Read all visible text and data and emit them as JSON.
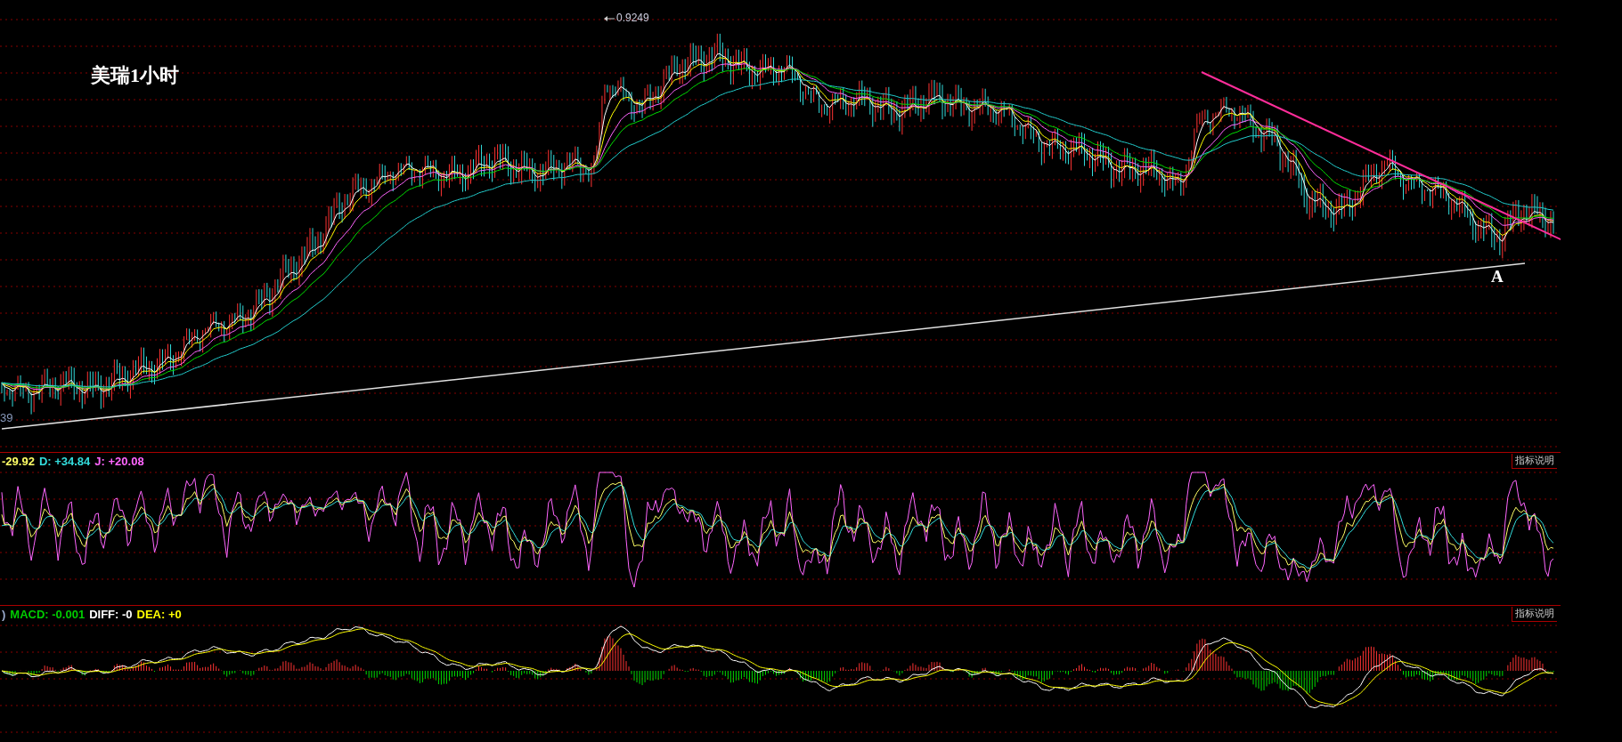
{
  "title": "美瑞1小时",
  "high_label": "0.9249",
  "low_label": "39",
  "point_label": "A",
  "kdj": {
    "readings": [
      {
        "text": "-29.92",
        "color": "#ffff66"
      },
      {
        "text": "D: +34.84",
        "color": "#33dddd"
      },
      {
        "text": "J: +20.08",
        "color": "#ff66ff"
      }
    ],
    "help_button": "指标说明"
  },
  "macd": {
    "readings": [
      {
        "text": ")",
        "color": "#99aacc"
      },
      {
        "text": "MACD: -0.001",
        "color": "#00cc00"
      },
      {
        "text": "DIFF: -0",
        "color": "#ffffff"
      },
      {
        "text": "DEA: +0",
        "color": "#ffff00"
      }
    ],
    "help_button": "指标说明"
  }
}
